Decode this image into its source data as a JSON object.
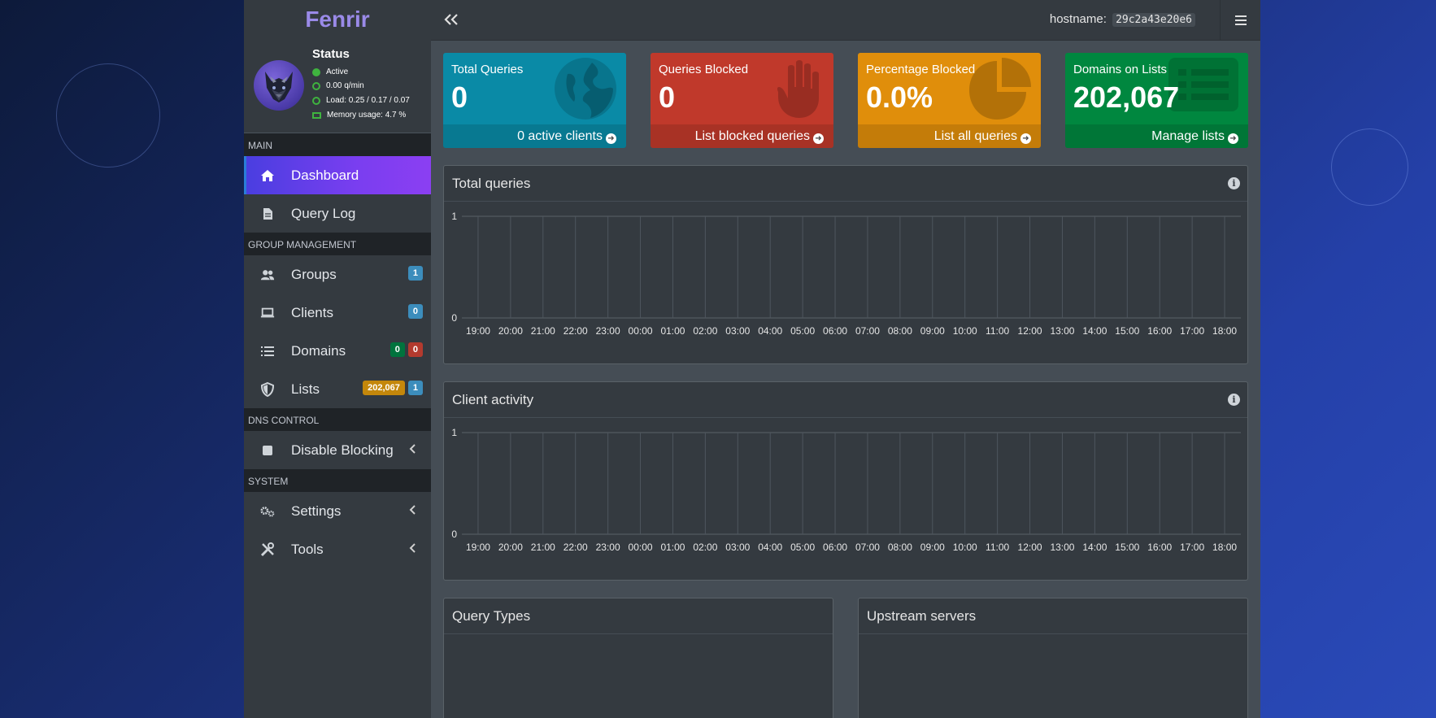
{
  "brand": "Fenrir",
  "status": {
    "title": "Status",
    "active": "Active",
    "rate": "0.00 q/min",
    "load": "Load: 0.25 / 0.17 / 0.07",
    "memory": "Memory usage: 4.7 %"
  },
  "nav": {
    "main_header": "MAIN",
    "dashboard": "Dashboard",
    "query_log": "Query Log",
    "group_header": "GROUP MANAGEMENT",
    "groups": "Groups",
    "groups_badge": "1",
    "clients": "Clients",
    "clients_badge": "0",
    "domains": "Domains",
    "domains_badge_allow": "0",
    "domains_badge_deny": "0",
    "lists": "Lists",
    "lists_badge_count": "202,067",
    "lists_badge_lists": "1",
    "dns_header": "DNS CONTROL",
    "disable_blocking": "Disable Blocking",
    "system_header": "SYSTEM",
    "settings": "Settings",
    "tools": "Tools"
  },
  "topbar": {
    "hostname_label": "hostname:",
    "hostname_value": "29c2a43e20e6"
  },
  "stats": {
    "total_queries": {
      "label": "Total Queries",
      "value": "0",
      "footer": "0 active clients"
    },
    "queries_blocked": {
      "label": "Queries Blocked",
      "value": "0",
      "footer": "List blocked queries"
    },
    "percentage_blocked": {
      "label": "Percentage Blocked",
      "value": "0.0%",
      "footer": "List all queries"
    },
    "domains_on_lists": {
      "label": "Domains on Lists",
      "value": "202,067",
      "footer": "Manage lists"
    }
  },
  "colors": {
    "total_queries": "#0a8aa6",
    "queries_blocked": "#c0392b",
    "percentage_blocked": "#e08e0b",
    "domains_on_lists": "#00873f",
    "active_nav": "#7a3ef0"
  },
  "cards": {
    "total_queries_title": "Total queries",
    "client_activity_title": "Client activity",
    "query_types_title": "Query Types",
    "upstream_title": "Upstream servers"
  },
  "chart_data": [
    {
      "type": "bar",
      "title": "Total queries",
      "categories": [
        "19:00",
        "20:00",
        "21:00",
        "22:00",
        "23:00",
        "00:00",
        "01:00",
        "02:00",
        "03:00",
        "04:00",
        "05:00",
        "06:00",
        "07:00",
        "08:00",
        "09:00",
        "10:00",
        "11:00",
        "12:00",
        "13:00",
        "14:00",
        "15:00",
        "16:00",
        "17:00",
        "18:00"
      ],
      "values": [
        0,
        0,
        0,
        0,
        0,
        0,
        0,
        0,
        0,
        0,
        0,
        0,
        0,
        0,
        0,
        0,
        0,
        0,
        0,
        0,
        0,
        0,
        0,
        0
      ],
      "ylim": [
        0,
        1
      ],
      "yticks": [
        "0",
        "1"
      ],
      "grid": true
    },
    {
      "type": "bar",
      "title": "Client activity",
      "categories": [
        "19:00",
        "20:00",
        "21:00",
        "22:00",
        "23:00",
        "00:00",
        "01:00",
        "02:00",
        "03:00",
        "04:00",
        "05:00",
        "06:00",
        "07:00",
        "08:00",
        "09:00",
        "10:00",
        "11:00",
        "12:00",
        "13:00",
        "14:00",
        "15:00",
        "16:00",
        "17:00",
        "18:00"
      ],
      "values": [
        0,
        0,
        0,
        0,
        0,
        0,
        0,
        0,
        0,
        0,
        0,
        0,
        0,
        0,
        0,
        0,
        0,
        0,
        0,
        0,
        0,
        0,
        0,
        0
      ],
      "ylim": [
        0,
        1
      ],
      "yticks": [
        "0",
        "1"
      ],
      "grid": true
    }
  ]
}
